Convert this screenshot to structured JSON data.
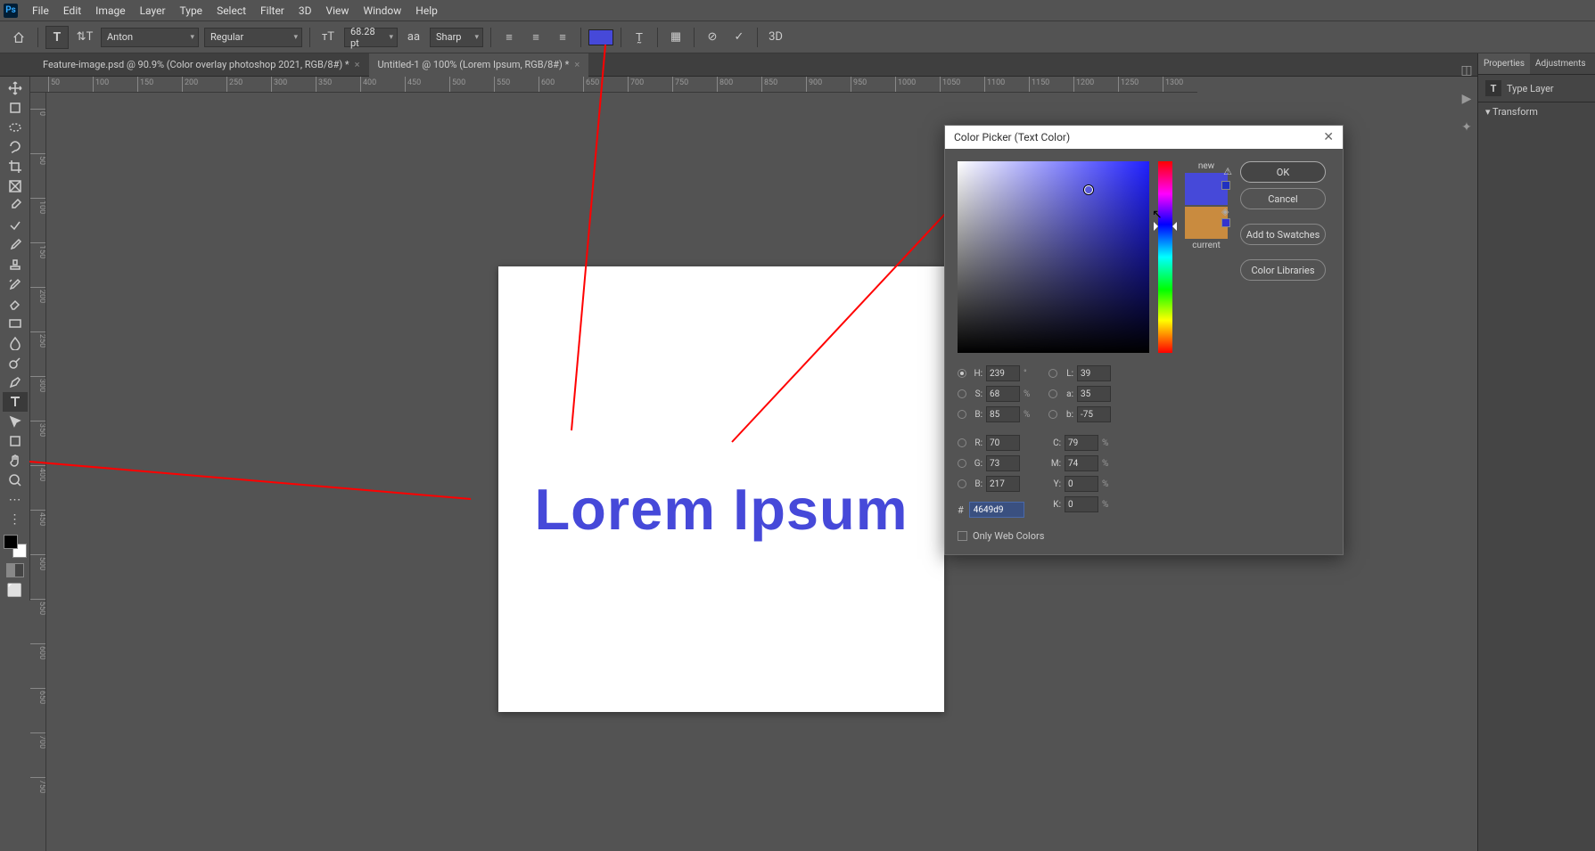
{
  "menu": {
    "items": [
      "File",
      "Edit",
      "Image",
      "Layer",
      "Type",
      "Select",
      "Filter",
      "3D",
      "View",
      "Window",
      "Help"
    ]
  },
  "optbar": {
    "font": "Anton",
    "weight": "Regular",
    "size": "68.28 pt",
    "aa": "Sharp",
    "color": "#4649d9"
  },
  "tabs": [
    {
      "label": "Feature-image.psd @ 90.9% (Color overlay  photoshop 2021, RGB/8#) *"
    },
    {
      "label": "Untitled-1 @ 100% (Lorem Ipsum, RGB/8#) *",
      "active": true
    }
  ],
  "ruler": {
    "h": [
      "50",
      "100",
      "150",
      "200",
      "250",
      "300",
      "350",
      "400",
      "450",
      "500",
      "550",
      "600",
      "650",
      "700",
      "750",
      "800",
      "850",
      "900",
      "950",
      "1000",
      "1050",
      "1100",
      "1150",
      "1200",
      "1250",
      "1300"
    ]
  },
  "canvas": {
    "text": "Lorem Ipsum"
  },
  "panels": {
    "right_tabs": [
      "Properties",
      "Adjustments"
    ],
    "panel_title": "Type Layer",
    "section": "Transform"
  },
  "picker": {
    "title": "Color Picker (Text Color)",
    "buttons": {
      "ok": "OK",
      "cancel": "Cancel",
      "swatch": "Add to Swatches",
      "lib": "Color Libraries"
    },
    "labels": {
      "new": "new",
      "current": "current"
    },
    "hsb": {
      "H": "239",
      "S": "68",
      "B": "85"
    },
    "rgb": {
      "R": "70",
      "G": "73",
      "B": "217"
    },
    "lab": {
      "L": "39",
      "a": "35",
      "b": "-75"
    },
    "cmyk": {
      "C": "79",
      "M": "74",
      "Y": "0",
      "K": "0"
    },
    "hex": "4649d9",
    "webonly": "Only Web Colors"
  }
}
